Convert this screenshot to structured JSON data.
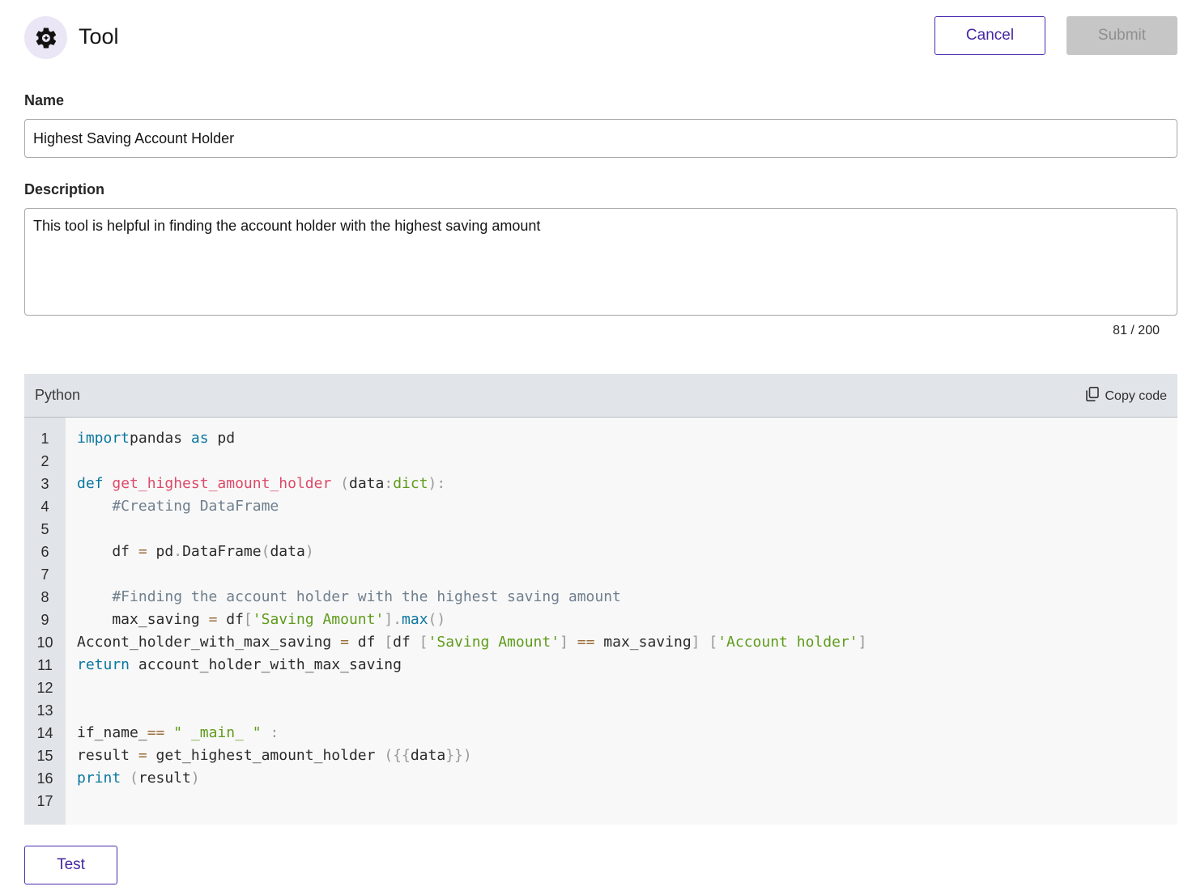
{
  "header": {
    "icon": "gear-sparkle-icon",
    "title": "Tool",
    "cancel_label": "Cancel",
    "submit_label": "Submit"
  },
  "form": {
    "name_label": "Name",
    "name_value": "Highest Saving Account Holder",
    "description_label": "Description",
    "description_value": "This tool is helpful in finding the account holder with the highest saving amount",
    "char_count": "81 / 200"
  },
  "code_block": {
    "language": "Python",
    "copy_label": "Copy code",
    "copy_icon": "copy-icon",
    "lines": [
      [
        [
          "kw",
          "import"
        ],
        [
          "",
          "pandas "
        ],
        [
          "kw",
          "as"
        ],
        [
          "",
          " pd"
        ]
      ],
      [],
      [
        [
          "kw",
          "def"
        ],
        [
          "",
          " "
        ],
        [
          "fn",
          "get_highest_amount_holder"
        ],
        [
          "",
          " "
        ],
        [
          "pn",
          "("
        ],
        [
          "",
          "data"
        ],
        [
          "pn",
          ":"
        ],
        [
          "str",
          "dict"
        ],
        [
          "pn",
          "):"
        ]
      ],
      [
        [
          "cm",
          "    #Creating DataFrame"
        ]
      ],
      [],
      [
        [
          "",
          "    df "
        ],
        [
          "op",
          "="
        ],
        [
          "",
          " pd"
        ],
        [
          "pn",
          "."
        ],
        [
          "",
          "DataFrame"
        ],
        [
          "pn",
          "("
        ],
        [
          "",
          "data"
        ],
        [
          "pn",
          ")"
        ]
      ],
      [],
      [
        [
          "cm",
          "    #Finding the account holder with the highest saving amount"
        ]
      ],
      [
        [
          "",
          "    max_saving "
        ],
        [
          "op",
          "="
        ],
        [
          "",
          " df"
        ],
        [
          "pn",
          "["
        ],
        [
          "str",
          "'Saving Amount'"
        ],
        [
          "pn",
          "]."
        ],
        [
          "kw",
          "max"
        ],
        [
          "pn",
          "()"
        ]
      ],
      [
        [
          "",
          "Accont_holder_with_max_saving "
        ],
        [
          "op",
          "="
        ],
        [
          "",
          " df "
        ],
        [
          "pn",
          "["
        ],
        [
          "",
          "df "
        ],
        [
          "pn",
          "["
        ],
        [
          "str",
          "'Saving Amount'"
        ],
        [
          "pn",
          "]"
        ],
        [
          "",
          " "
        ],
        [
          "op",
          "=="
        ],
        [
          "",
          " max_saving"
        ],
        [
          "pn",
          "]"
        ],
        [
          "",
          " "
        ],
        [
          "pn",
          "["
        ],
        [
          "str",
          "'Account holder'"
        ],
        [
          "pn",
          "]"
        ]
      ],
      [
        [
          "kw",
          "return"
        ],
        [
          "",
          " account_holder_with_max_saving"
        ]
      ],
      [],
      [],
      [
        [
          "",
          "if_name_"
        ],
        [
          "op",
          "=="
        ],
        [
          "",
          " "
        ],
        [
          "str",
          "\" _main_ \""
        ],
        [
          "",
          " "
        ],
        [
          "pn",
          ":"
        ]
      ],
      [
        [
          "",
          "result "
        ],
        [
          "op",
          "="
        ],
        [
          "",
          " get_highest_amount_holder "
        ],
        [
          "pn",
          "({{"
        ],
        [
          "",
          "data"
        ],
        [
          "pn",
          "}})"
        ]
      ],
      [
        [
          "kw",
          "print"
        ],
        [
          "",
          " "
        ],
        [
          "pn",
          "("
        ],
        [
          "",
          "result"
        ],
        [
          "pn",
          ")"
        ]
      ],
      []
    ]
  },
  "actions": {
    "test_label": "Test"
  },
  "colors": {
    "accent": "#4527a0",
    "keyword": "#0b77a0",
    "function": "#dd4a68",
    "string": "#5f9b1a",
    "comment": "#6f7f8e"
  }
}
